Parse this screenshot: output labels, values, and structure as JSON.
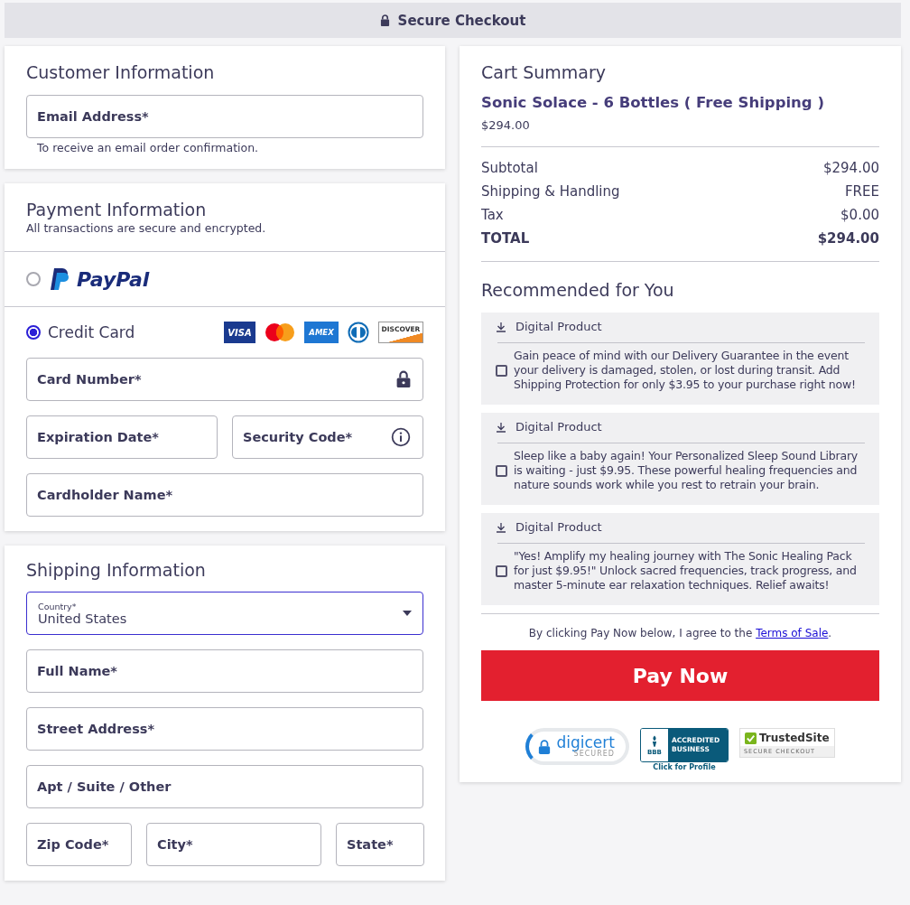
{
  "header": {
    "title": "Secure Checkout"
  },
  "customer": {
    "title": "Customer Information",
    "email": {
      "placeholder": "Email Address*"
    },
    "hint": "To receive an email order confirmation."
  },
  "payment": {
    "title": "Payment Information",
    "subtitle": "All transactions are secure and encrypted.",
    "methods": [
      {
        "kind": "paypal",
        "label": "PayPal",
        "selected": false
      },
      {
        "kind": "card",
        "label": "Credit Card",
        "selected": true
      }
    ],
    "card_brands": [
      {
        "kind": "visa",
        "text": "VISA"
      },
      {
        "kind": "mastercard"
      },
      {
        "kind": "amex",
        "text": "AMEX"
      },
      {
        "kind": "diners"
      },
      {
        "kind": "discover",
        "text": "DISCOVER"
      }
    ],
    "card_number": {
      "placeholder": "Card Number*"
    },
    "expiration": {
      "placeholder": "Expiration Date*"
    },
    "security_code": {
      "placeholder": "Security Code*"
    },
    "cardholder": {
      "placeholder": "Cardholder Name*"
    }
  },
  "shipping": {
    "title": "Shipping Information",
    "country": {
      "label": "Country*",
      "value": "United States"
    },
    "full_name": {
      "placeholder": "Full Name*"
    },
    "street": {
      "placeholder": "Street Address*"
    },
    "apt": {
      "placeholder": "Apt / Suite / Other"
    },
    "zip": {
      "placeholder": "Zip Code*"
    },
    "city": {
      "placeholder": "City*"
    },
    "state": {
      "placeholder": "State*"
    }
  },
  "cart": {
    "title": "Cart Summary",
    "product": "Sonic Solace - 6 Bottles ( Free Shipping )",
    "product_price": "$294.00",
    "lines": [
      {
        "label": "Subtotal",
        "value": "$294.00",
        "kind": "normal"
      },
      {
        "label": "Shipping & Handling",
        "value": "FREE",
        "kind": "normal"
      },
      {
        "label": "Tax",
        "value": "$0.00",
        "kind": "normal"
      },
      {
        "label": "TOTAL",
        "value": "$294.00",
        "kind": "total"
      }
    ],
    "recommended_title": "Recommended for You",
    "offers": [
      {
        "tag": "Digital Product",
        "text": "Gain peace of mind with our Delivery Guarantee in the event your delivery is damaged, stolen, or lost during transit. Add Shipping Protection for only $3.95 to your purchase right now!",
        "checked": false
      },
      {
        "tag": "Digital Product",
        "text": "Sleep like a baby again! Your Personalized Sleep Sound Library is waiting - just $9.95. These powerful healing frequencies and nature sounds work while you rest to retrain your brain.",
        "checked": false
      },
      {
        "tag": "Digital Product",
        "text": "\"Yes! Amplify my healing journey with The Sonic Healing Pack for just $9.95!\" Unlock sacred frequencies, track progress, and master 5-minute ear relaxation techniques. Relief awaits!",
        "checked": false
      }
    ],
    "agree_text": "By clicking Pay Now below, I agree to the",
    "terms_link": "Terms of Sale",
    "agree_end": ".",
    "pay_button": "Pay Now",
    "badges": {
      "digicert": "digicert",
      "digicert_sub": "SECURED",
      "bbb": "BBB",
      "bbb_text": "ACCREDITED BUSINESS",
      "bbb_link": "Click for Profile",
      "trusted": "TrustedSite",
      "trusted_sub": "SECURE CHECKOUT"
    }
  }
}
